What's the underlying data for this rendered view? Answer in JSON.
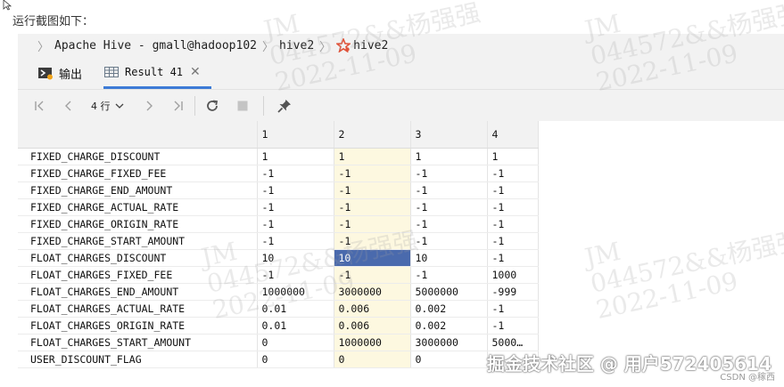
{
  "caption": "运行截图如下：",
  "breadcrumb": {
    "items": [
      "Apache Hive - gmall@hadoop102",
      "hive2",
      "hive2"
    ]
  },
  "tabs": {
    "output_label": "输出",
    "result_label": "Result 41"
  },
  "toolbar": {
    "rows_label": "4 行"
  },
  "grid": {
    "columns": [
      "1",
      "2",
      "3",
      "4"
    ],
    "rows": [
      {
        "name": "FIXED_CHARGE_DISCOUNT",
        "values": [
          "1",
          "1",
          "1",
          "1"
        ]
      },
      {
        "name": "FIXED_CHARGE_FIXED_FEE",
        "values": [
          "-1",
          "-1",
          "-1",
          "-1"
        ]
      },
      {
        "name": "FIXED_CHARGE_END_AMOUNT",
        "values": [
          "-1",
          "-1",
          "-1",
          "-1"
        ]
      },
      {
        "name": "FIXED_CHARGE_ACTUAL_RATE",
        "values": [
          "-1",
          "-1",
          "-1",
          "-1"
        ]
      },
      {
        "name": "FIXED_CHARGE_ORIGIN_RATE",
        "values": [
          "-1",
          "-1",
          "-1",
          "-1"
        ]
      },
      {
        "name": "FIXED_CHARGE_START_AMOUNT",
        "values": [
          "-1",
          "-1",
          "-1",
          "-1"
        ]
      },
      {
        "name": "FLOAT_CHARGES_DISCOUNT",
        "values": [
          "10",
          "10",
          "10",
          "-1"
        ]
      },
      {
        "name": "FLOAT_CHARGES_FIXED_FEE",
        "values": [
          "-1",
          "-1",
          "-1",
          "1000"
        ]
      },
      {
        "name": "FLOAT_CHARGES_END_AMOUNT",
        "values": [
          "1000000",
          "3000000",
          "5000000",
          "-999"
        ]
      },
      {
        "name": "FLOAT_CHARGES_ACTUAL_RATE",
        "values": [
          "0.01",
          "0.006",
          "0.002",
          "-1"
        ]
      },
      {
        "name": "FLOAT_CHARGES_ORIGIN_RATE",
        "values": [
          "0.01",
          "0.006",
          "0.002",
          "-1"
        ]
      },
      {
        "name": "FLOAT_CHARGES_START_AMOUNT",
        "values": [
          "0",
          "1000000",
          "3000000",
          "5000…"
        ]
      },
      {
        "name": "USER_DISCOUNT_FLAG",
        "values": [
          "0",
          "0",
          "0",
          ""
        ]
      }
    ],
    "highlight_column_index": 1,
    "selected_cell": {
      "row": 6,
      "col": 1
    }
  },
  "watermarks": {
    "line1": "JM",
    "line2": "044572&&杨强强",
    "line3": "2022-11-09"
  },
  "footer": {
    "site_text": "掘金技术社区 @ 用户572405614",
    "csdn_text": "CSDN @稼西"
  },
  "colors": {
    "accent": "#3d7bd6",
    "selected_cell": "#4a6aad",
    "highlight_column": "#fdf8e0"
  }
}
